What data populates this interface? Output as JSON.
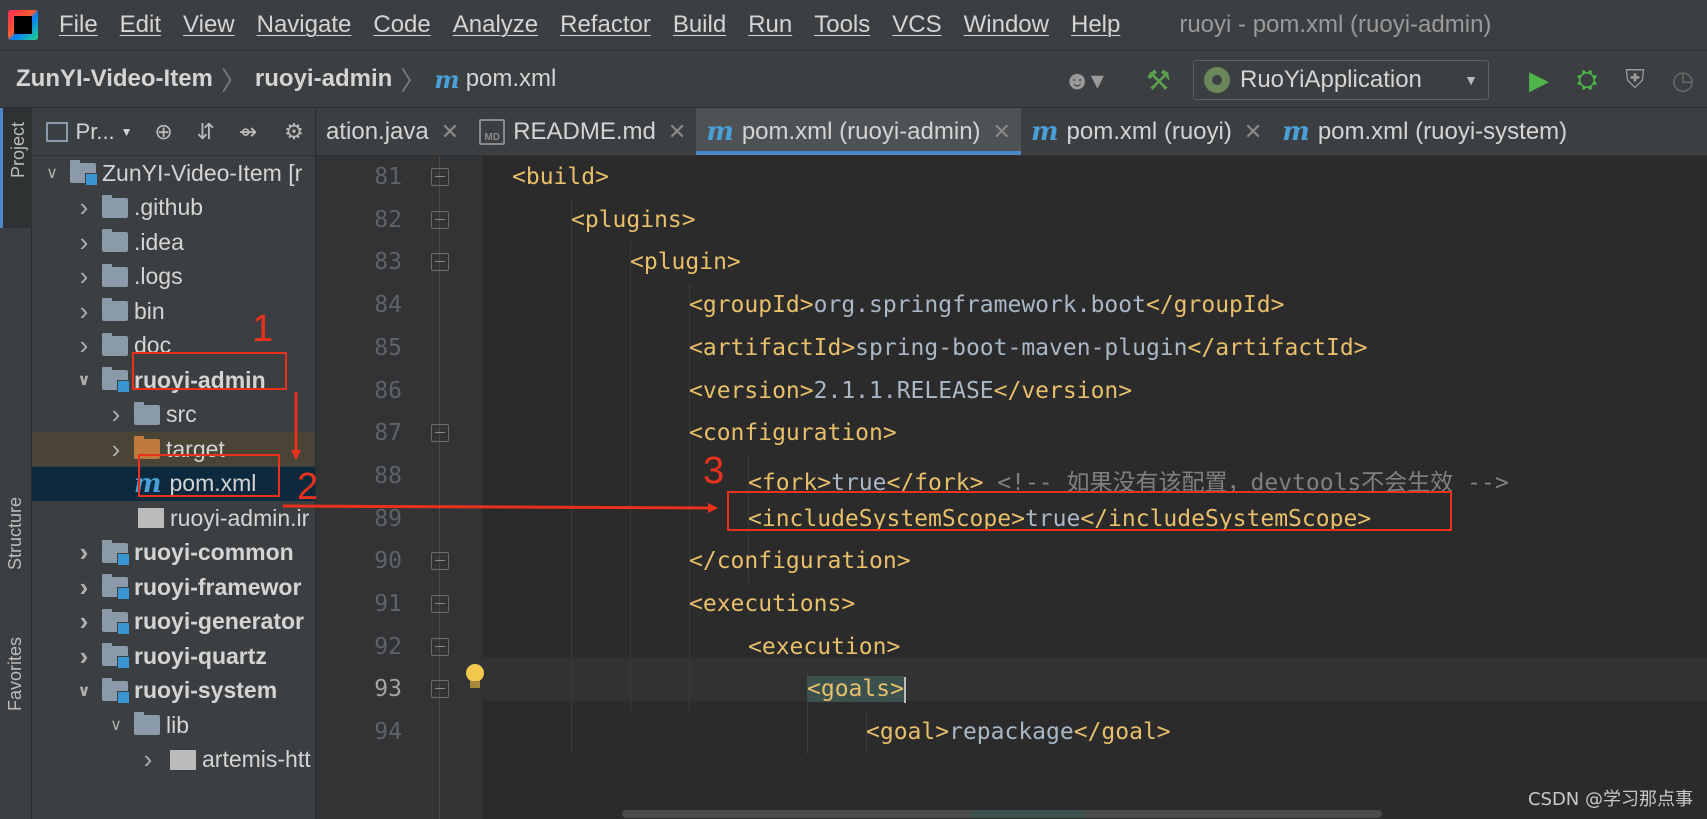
{
  "menubar": {
    "items": [
      "File",
      "Edit",
      "View",
      "Navigate",
      "Code",
      "Analyze",
      "Refactor",
      "Build",
      "Run",
      "Tools",
      "VCS",
      "Window",
      "Help"
    ],
    "window_title": "ruoyi - pom.xml (ruoyi-admin)"
  },
  "navbar": {
    "breadcrumbs": [
      "ZunYI-Video-Item",
      "ruoyi-admin",
      "pom.xml"
    ],
    "run_config": "RuoYiApplication"
  },
  "left_stripe": {
    "project": "Project",
    "structure": "Structure",
    "favorites": "Favorites"
  },
  "project_panel": {
    "title": "Pr...",
    "tree": [
      {
        "label": "ZunYI-Video-Item [r",
        "indent": 0,
        "arrow": "down",
        "kind": "module",
        "bold": false
      },
      {
        "label": ".github",
        "indent": 1,
        "arrow": "right",
        "kind": "folder",
        "bold": false
      },
      {
        "label": ".idea",
        "indent": 1,
        "arrow": "right",
        "kind": "folder",
        "bold": false
      },
      {
        "label": ".logs",
        "indent": 1,
        "arrow": "right",
        "kind": "folder",
        "bold": false
      },
      {
        "label": "bin",
        "indent": 1,
        "arrow": "right",
        "kind": "folder",
        "bold": false
      },
      {
        "label": "doc",
        "indent": 1,
        "arrow": "right",
        "kind": "folder",
        "bold": false
      },
      {
        "label": "ruoyi-admin",
        "indent": 1,
        "arrow": "down",
        "kind": "module",
        "bold": true
      },
      {
        "label": "src",
        "indent": 2,
        "arrow": "right",
        "kind": "folder",
        "bold": false
      },
      {
        "label": "target",
        "indent": 2,
        "arrow": "right",
        "kind": "folder-orange",
        "bold": false
      },
      {
        "label": "pom.xml",
        "indent": 2,
        "arrow": "",
        "kind": "maven",
        "bold": false
      },
      {
        "label": "ruoyi-admin.ir",
        "indent": 2,
        "arrow": "",
        "kind": "file",
        "bold": false
      },
      {
        "label": "ruoyi-common",
        "indent": 1,
        "arrow": "right",
        "kind": "module",
        "bold": true
      },
      {
        "label": "ruoyi-framewor",
        "indent": 1,
        "arrow": "right",
        "kind": "module",
        "bold": true
      },
      {
        "label": "ruoyi-generator",
        "indent": 1,
        "arrow": "right",
        "kind": "module",
        "bold": true
      },
      {
        "label": "ruoyi-quartz",
        "indent": 1,
        "arrow": "right",
        "kind": "module",
        "bold": true
      },
      {
        "label": "ruoyi-system",
        "indent": 1,
        "arrow": "down",
        "kind": "module",
        "bold": true
      },
      {
        "label": "lib",
        "indent": 2,
        "arrow": "down",
        "kind": "folder",
        "bold": false
      },
      {
        "label": "artemis-htt",
        "indent": 3,
        "arrow": "right",
        "kind": "jar",
        "bold": false
      }
    ]
  },
  "tabs": [
    {
      "label": "ation.java",
      "icon": "",
      "active": false
    },
    {
      "label": "README.md",
      "icon": "md",
      "active": false
    },
    {
      "label": "pom.xml (ruoyi-admin)",
      "icon": "m",
      "active": true
    },
    {
      "label": "pom.xml (ruoyi)",
      "icon": "m",
      "active": false
    },
    {
      "label": "pom.xml (ruoyi-system)",
      "icon": "m",
      "active": false
    }
  ],
  "editor": {
    "current_line": 93,
    "lines": [
      {
        "no": "81",
        "fold": true,
        "indent": 0,
        "parts": [
          [
            "tag",
            "<build>"
          ]
        ]
      },
      {
        "no": "82",
        "fold": true,
        "indent": 1,
        "parts": [
          [
            "tag",
            "<plugins>"
          ]
        ]
      },
      {
        "no": "83",
        "fold": true,
        "indent": 2,
        "parts": [
          [
            "tag",
            "<plugin>"
          ]
        ]
      },
      {
        "no": "84",
        "fold": false,
        "indent": 3,
        "parts": [
          [
            "tag",
            "<groupId>"
          ],
          [
            "txt",
            "org.springframework.boot"
          ],
          [
            "tag",
            "</groupId>"
          ]
        ]
      },
      {
        "no": "85",
        "fold": false,
        "indent": 3,
        "parts": [
          [
            "tag",
            "<artifactId>"
          ],
          [
            "txt",
            "spring-boot-maven-plugin"
          ],
          [
            "tag",
            "</artifactId>"
          ]
        ]
      },
      {
        "no": "86",
        "fold": false,
        "indent": 3,
        "parts": [
          [
            "tag",
            "<version>"
          ],
          [
            "txt",
            "2.1.1.RELEASE"
          ],
          [
            "tag",
            "</version>"
          ]
        ]
      },
      {
        "no": "87",
        "fold": true,
        "indent": 3,
        "parts": [
          [
            "tag",
            "<configuration>"
          ]
        ]
      },
      {
        "no": "88",
        "fold": false,
        "indent": 4,
        "parts": [
          [
            "tag",
            "<fork>"
          ],
          [
            "txt",
            "true"
          ],
          [
            "tag",
            "</fork>"
          ],
          [
            "cmt",
            " <!-- 如果没有该配置，devtools不会生效 -->"
          ]
        ]
      },
      {
        "no": "89",
        "fold": false,
        "indent": 4,
        "parts": [
          [
            "tag",
            "<includeSystemScope>"
          ],
          [
            "txt",
            "true"
          ],
          [
            "tag",
            "</includeSystemScope>"
          ]
        ]
      },
      {
        "no": "90",
        "fold": true,
        "indent": 3,
        "parts": [
          [
            "tag",
            "</configuration>"
          ]
        ]
      },
      {
        "no": "91",
        "fold": true,
        "indent": 3,
        "parts": [
          [
            "tag",
            "<executions>"
          ]
        ]
      },
      {
        "no": "92",
        "fold": true,
        "indent": 4,
        "parts": [
          [
            "tag",
            "<execution>"
          ]
        ]
      },
      {
        "no": "93",
        "fold": true,
        "indent": 5,
        "parts": [
          [
            "tag",
            "<goals>"
          ]
        ]
      },
      {
        "no": "94",
        "fold": false,
        "indent": 6,
        "parts": [
          [
            "tag",
            "<goal>"
          ],
          [
            "txt",
            "repackage"
          ],
          [
            "tag",
            "</goal>"
          ]
        ]
      }
    ]
  },
  "annotations": [
    "1",
    "2",
    "3"
  ],
  "watermark": "CSDN @学习那点事",
  "colors": {
    "annotation": "#e8321e",
    "accent": "#4a88c7",
    "tag": "#e8bf6a",
    "text": "#a9b7c6"
  }
}
